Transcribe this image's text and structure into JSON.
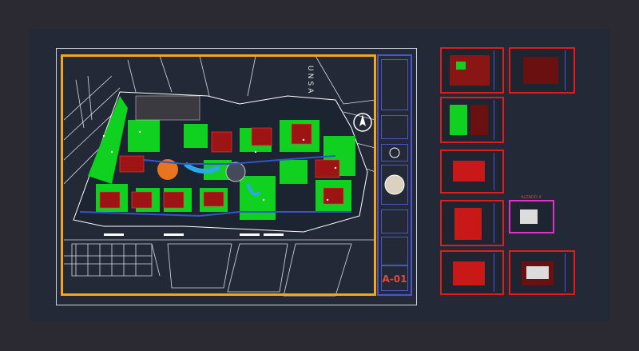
{
  "drawing": {
    "street_label": "UNSA",
    "sheet_code": "A-01",
    "thumb_label": "ALZADO 4"
  },
  "colors": {
    "background": "#2b2a33",
    "model_space": "#232936",
    "site_border": "#f3a81c",
    "title_block": "#4a57c8",
    "green_area": "#10d020",
    "sheet_border": "#e01d1d",
    "selected_sheet_border": "#e032c8"
  },
  "sheets": [
    {
      "id": "floorplan-1",
      "active": false
    },
    {
      "id": "floorplan-2",
      "active": false
    },
    {
      "id": "floorplan-3",
      "active": false
    },
    {
      "id": "elevation-1",
      "active": false
    },
    {
      "id": "elevation-2",
      "active": false
    },
    {
      "id": "elevation-selected",
      "active": true
    },
    {
      "id": "elevation-3",
      "active": false
    },
    {
      "id": "elevation-4",
      "active": false
    }
  ]
}
